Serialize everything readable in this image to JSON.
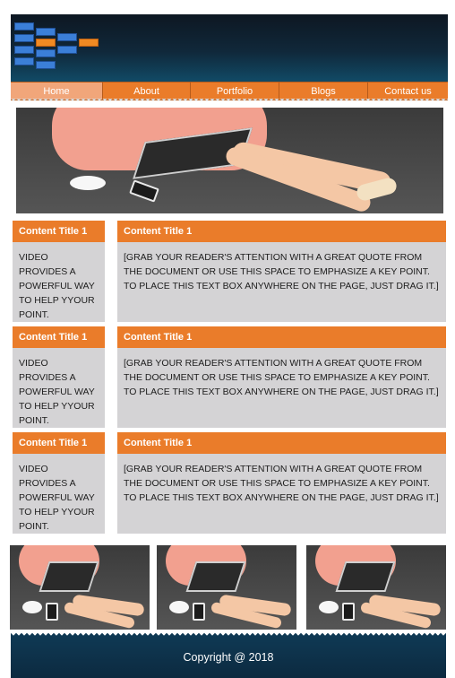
{
  "nav": {
    "items": [
      "Home",
      "About",
      "Portfolio",
      "Blogs",
      "Contact us"
    ],
    "active": 0
  },
  "colors": {
    "accent": "#ea7c2a",
    "panel": "#d4d3d5",
    "header_dark": "#0d1722"
  },
  "rows": [
    {
      "left_title": "Content Title 1",
      "left_text": "VIDEO PROVIDES A POWERFUL WAY TO HELP YYOUR POINT.",
      "right_title": "Content Title 1",
      "right_text": "[GRAB YOUR READER'S ATTENTION WITH A GREAT QUOTE FROM THE DOCUMENT OR USE THIS SPACE TO EMPHASIZE A KEY POINT. TO PLACE THIS TEXT BOX ANYWHERE ON THE PAGE, JUST DRAG IT.]"
    },
    {
      "left_title": "Content Title 1",
      "left_text": "VIDEO PROVIDES A POWERFUL WAY TO HELP YYOUR POINT.",
      "right_title": "Content Title 1",
      "right_text": "[GRAB YOUR READER'S ATTENTION WITH A GREAT QUOTE FROM THE DOCUMENT OR USE THIS SPACE TO EMPHASIZE A KEY POINT. TO PLACE THIS TEXT BOX ANYWHERE ON THE PAGE, JUST DRAG IT.]"
    },
    {
      "left_title": "Content Title 1",
      "left_text": "VIDEO PROVIDES A POWERFUL WAY TO HELP YYOUR POINT.",
      "right_title": "Content Title 1",
      "right_text": "[GRAB YOUR READER'S ATTENTION WITH A GREAT QUOTE FROM THE DOCUMENT OR USE THIS SPACE TO EMPHASIZE A KEY POINT. TO PLACE THIS TEXT BOX ANYWHERE ON THE PAGE, JUST DRAG IT.]"
    }
  ],
  "footer": {
    "copyright": "Copyright @ 2018"
  }
}
